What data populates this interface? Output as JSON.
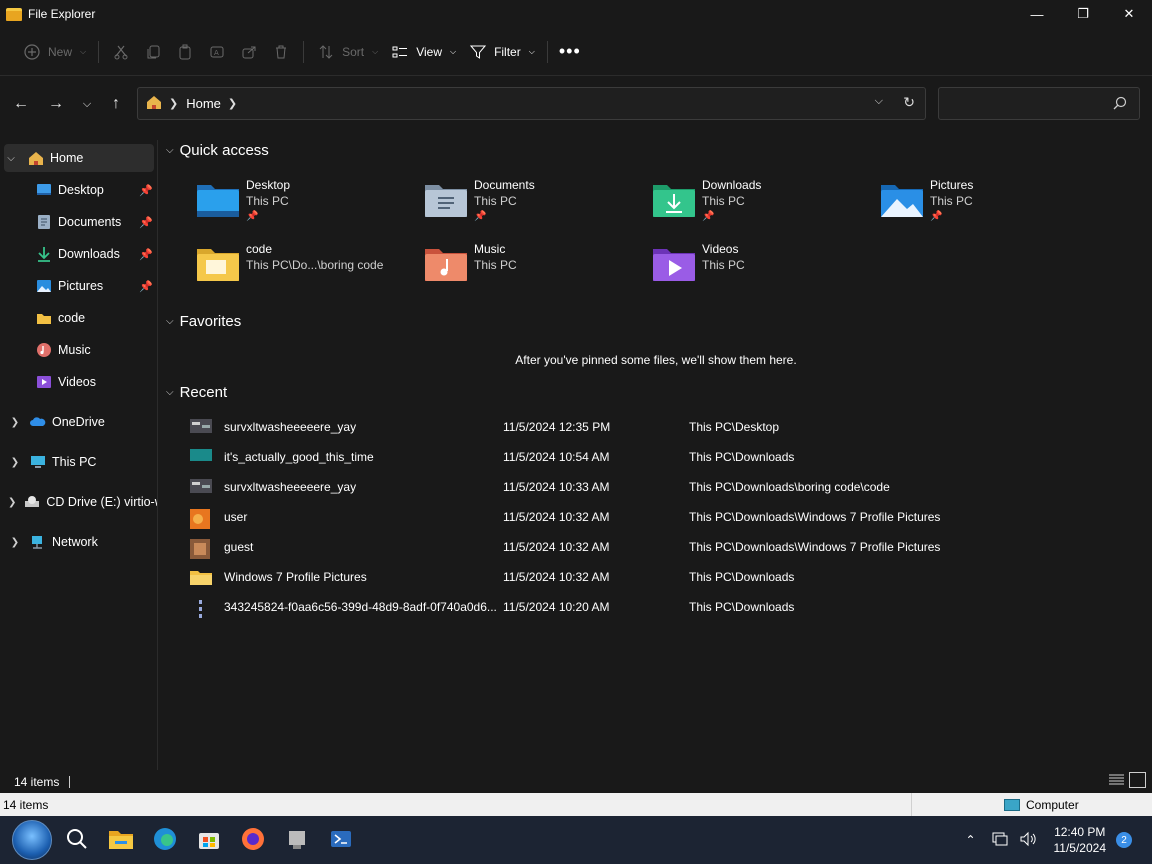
{
  "window": {
    "title": "File Explorer"
  },
  "toolbar": {
    "new_label": "New",
    "sort_label": "Sort",
    "view_label": "View",
    "filter_label": "Filter"
  },
  "address": {
    "crumb": "Home"
  },
  "sidebar": {
    "items": [
      {
        "label": "Home"
      },
      {
        "label": "Desktop"
      },
      {
        "label": "Documents"
      },
      {
        "label": "Downloads"
      },
      {
        "label": "Pictures"
      },
      {
        "label": "code"
      },
      {
        "label": "Music"
      },
      {
        "label": "Videos"
      },
      {
        "label": "OneDrive"
      },
      {
        "label": "This PC"
      },
      {
        "label": "CD Drive (E:) virtio-w"
      },
      {
        "label": "Network"
      }
    ]
  },
  "sections": {
    "quick_access": "Quick access",
    "favorites": "Favorites",
    "recent": "Recent"
  },
  "quick_access": [
    {
      "name": "Desktop",
      "sub": "This PC"
    },
    {
      "name": "Documents",
      "sub": "This PC"
    },
    {
      "name": "Downloads",
      "sub": "This PC"
    },
    {
      "name": "Pictures",
      "sub": "This PC"
    },
    {
      "name": "code",
      "sub": "This PC\\Do...\\boring code"
    },
    {
      "name": "Music",
      "sub": "This PC"
    },
    {
      "name": "Videos",
      "sub": "This PC"
    }
  ],
  "favorites_empty": "After you've pinned some files, we'll show them here.",
  "recent": [
    {
      "name": "survxltwasheeeeere_yay",
      "date": "11/5/2024 12:35 PM",
      "location": "This PC\\Desktop"
    },
    {
      "name": "it's_actually_good_this_time",
      "date": "11/5/2024 10:54 AM",
      "location": "This PC\\Downloads"
    },
    {
      "name": "survxltwasheeeeere_yay",
      "date": "11/5/2024 10:33 AM",
      "location": "This PC\\Downloads\\boring code\\code"
    },
    {
      "name": "user",
      "date": "11/5/2024 10:32 AM",
      "location": "This PC\\Downloads\\Windows 7 Profile Pictures"
    },
    {
      "name": "guest",
      "date": "11/5/2024 10:32 AM",
      "location": "This PC\\Downloads\\Windows 7 Profile Pictures"
    },
    {
      "name": "Windows 7 Profile Pictures",
      "date": "11/5/2024 10:32 AM",
      "location": "This PC\\Downloads"
    },
    {
      "name": "343245824-f0aa6c56-399d-48d9-8adf-0f740a0d6...",
      "date": "11/5/2024 10:20 AM",
      "location": "This PC\\Downloads"
    }
  ],
  "status": {
    "count": "14 items",
    "bottom_count": "14 items",
    "zone": "Computer"
  },
  "taskbar": {
    "time": "12:40 PM",
    "date": "11/5/2024",
    "notifications": "2"
  }
}
